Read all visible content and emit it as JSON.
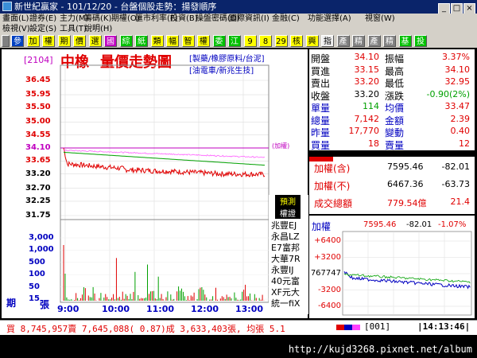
{
  "window": {
    "title": "新世紀贏家 - 101/12/20 - 台盤個股走勢：揚發順序"
  },
  "menu_row1": [
    "畫面(L)",
    "證券(E)",
    "主力(M)",
    "籌碼(K)",
    "期權(O)",
    "匯市利率(F)",
    "投資(B)",
    "操盤密碼(D)",
    "國際資訊(I)",
    "金融(C)",
    "功能選擇(A)",
    "視窗(W)"
  ],
  "menu_row2": [
    "檢視(V)",
    "設定(S)",
    "工具(T)",
    "說明(H)"
  ],
  "toolbar": [
    "參",
    "加",
    "權",
    "期",
    "價",
    "選",
    "國",
    "綜",
    "紙",
    "類",
    "幅",
    "智",
    "權",
    "委",
    "江",
    "9",
    "8",
    "29",
    "核",
    "興",
    "指",
    "產",
    "精",
    "產",
    "精",
    "基",
    "投"
  ],
  "header": {
    "code": "[2104]",
    "name": "中橡",
    "title": "量價走勢圖",
    "sector1": "[製藥/橡膠原料/台泥]",
    "sector2": "[油電車/新兆生技]"
  },
  "quote": {
    "rows": [
      {
        "l1": "開盤",
        "v1": "34.10",
        "l2": "振幅",
        "v2": "3.37%"
      },
      {
        "l1": "買進",
        "v1": "33.15",
        "l2": "最高",
        "v2": "34.10"
      },
      {
        "l1": "賣出",
        "v1": "33.20",
        "l2": "最低",
        "v2": "32.95"
      },
      {
        "l1": "收盤",
        "v1": "33.20",
        "l2": "漲跌",
        "v2": "-0.90(2%)"
      },
      {
        "l1": "單量",
        "v1": "114",
        "l2": "均價",
        "v2": "33.47"
      },
      {
        "l1": "總量",
        "v1": "7,142",
        "l2": "金額",
        "v2": "2.39"
      },
      {
        "l1": "昨量",
        "v1": "17,770",
        "l2": "變動",
        "v2": "0.40"
      },
      {
        "l1": "買量",
        "v1": "18",
        "l2": "賣量",
        "v2": "12"
      }
    ]
  },
  "index_summary": {
    "rows": [
      {
        "label": "加權(含)",
        "value": "7595.46",
        "change": "-82.01"
      },
      {
        "label": "加權(不)",
        "value": "6467.36",
        "change": "-63.73"
      },
      {
        "label": "成交總額",
        "value": "779.54億",
        "change": "21.4"
      }
    ]
  },
  "mini_index": {
    "label": "加權",
    "value": "7595.46",
    "change": "-82.01",
    "pct": "-1.07%",
    "y_ticks": [
      "+6400",
      "+3200",
      "767747",
      "-3200",
      "-6400"
    ]
  },
  "broker_list": {
    "header1": "預測",
    "header2": "權證",
    "items": [
      "兆豐EJ",
      "永昌LZ",
      "E7富邦",
      "大華7R",
      "永豐IJ",
      "40元富",
      "XF元大",
      "統一fiX"
    ]
  },
  "price_axis": [
    "36.45",
    "35.95",
    "35.50",
    "35.00",
    "34.55",
    "34.10",
    "33.65",
    "33.20",
    "32.70",
    "32.25",
    "31.75"
  ],
  "volume_axis": [
    "3,000",
    "1,000",
    "500",
    "100",
    "50",
    "15"
  ],
  "volume_unit": "張",
  "period_label": "期",
  "reference_label": "(加權)",
  "time_axis": [
    "9:00",
    "10:00",
    "11:00",
    "12:00",
    "13:00"
  ],
  "ticker": {
    "text": "買 8,745,957賣 7,645,088( 0.87)成 3,633,403張, 均張 5.1",
    "code": "001",
    "time": "14:13:46"
  },
  "url": "http://kujd3268.pixnet.net/album",
  "colors": {
    "up": "#e00000",
    "down": "#00a000",
    "avg": "#00a000",
    "accent": "#0000c0",
    "bg": "#ffffff"
  }
}
